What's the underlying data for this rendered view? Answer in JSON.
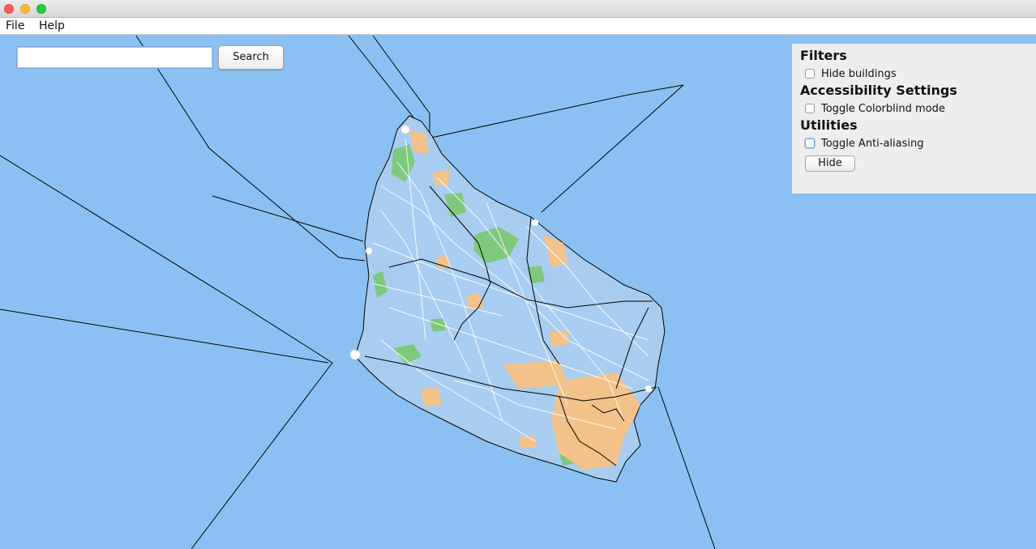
{
  "window": {
    "buttons": [
      "close",
      "minimize",
      "maximize"
    ]
  },
  "menu": {
    "items": [
      {
        "label": "File"
      },
      {
        "label": "Help"
      }
    ]
  },
  "search": {
    "value": "",
    "button_label": "Search"
  },
  "panel": {
    "filters_title": "Filters",
    "hide_buildings_label": "Hide buildings",
    "hide_buildings_checked": false,
    "accessibility_title": "Accessibility Settings",
    "colorblind_label": "Toggle Colorblind mode",
    "colorblind_checked": false,
    "utilities_title": "Utilities",
    "antialias_label": "Toggle Anti-aliasing",
    "antialias_checked": false,
    "hide_button_label": "Hide"
  },
  "map": {
    "colors": {
      "water": "#8bc1f2",
      "land": "#a9cdf0",
      "park": "#7fc97f",
      "urban": "#f2c28a",
      "road": "#ffffff",
      "line": "#000000"
    }
  }
}
